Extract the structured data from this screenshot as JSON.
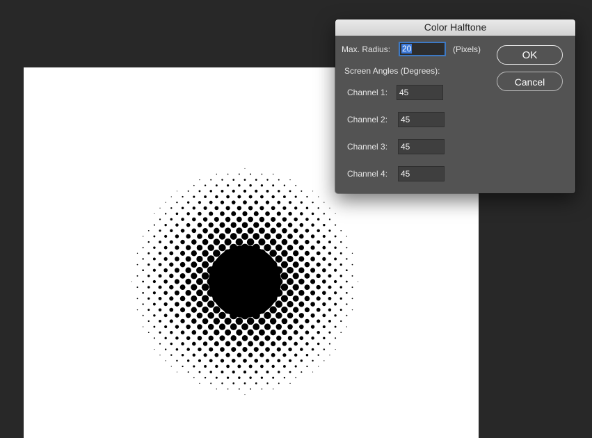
{
  "dialog": {
    "title": "Color Halftone",
    "max_radius_label": "Max. Radius:",
    "max_radius_value": "20",
    "max_radius_unit": "(Pixels)",
    "screen_angles_label": "Screen Angles (Degrees):",
    "channels": [
      {
        "label": "Channel 1:",
        "value": "45"
      },
      {
        "label": "Channel 2:",
        "value": "45"
      },
      {
        "label": "Channel 3:",
        "value": "45"
      },
      {
        "label": "Channel 4:",
        "value": "45"
      }
    ],
    "ok_label": "OK",
    "cancel_label": "Cancel"
  },
  "canvas": {
    "background_color": "#ffffff",
    "dot_color": "#000000",
    "workspace_color": "#282828"
  }
}
